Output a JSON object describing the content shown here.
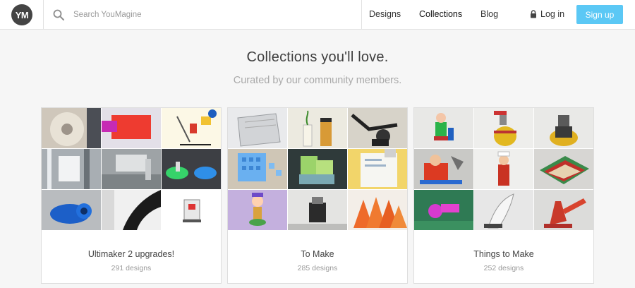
{
  "header": {
    "logo_text": "YM",
    "search_placeholder": "Search YouMagine",
    "nav": {
      "designs": "Designs",
      "collections": "Collections",
      "blog": "Blog"
    },
    "login_label": "Log in",
    "signup_label": "Sign up",
    "signup_color": "#5bc8f5"
  },
  "hero": {
    "title": "Collections you'll love.",
    "subtitle": "Curated by our community members."
  },
  "collections": [
    {
      "title": "Ultimaker 2 upgrades!",
      "count": "291 designs"
    },
    {
      "title": "To Make",
      "count": "285 designs"
    },
    {
      "title": "Things to Make",
      "count": "252 designs"
    }
  ]
}
